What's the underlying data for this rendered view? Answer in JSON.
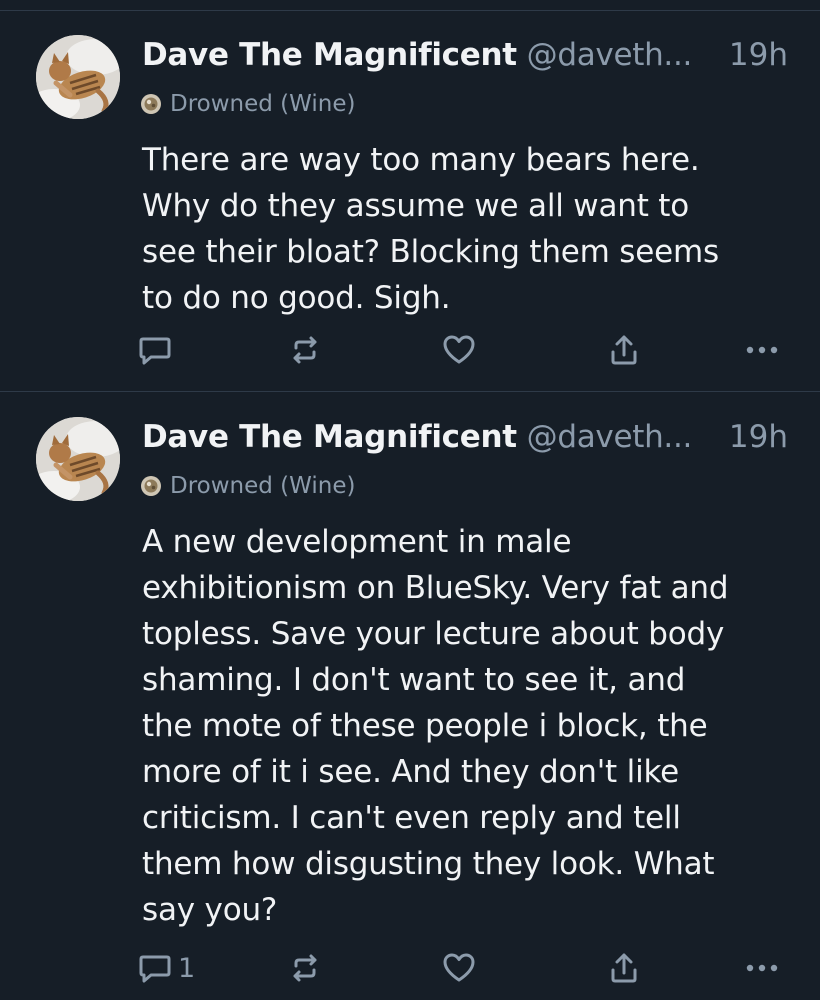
{
  "posts": [
    {
      "author": {
        "display_name": "Dave The Magnificent",
        "handle": "@daveth...",
        "avatar_icon": "cat-avatar"
      },
      "time": "19h",
      "label": {
        "icon": "badge-icon",
        "text": "Drowned (Wine)"
      },
      "text": "There are way too many bears here.\nWhy do they assume we all want to\nsee their bloat? Blocking them seems\nto do no good. Sigh.",
      "actions": {
        "reply_count": "",
        "icons": [
          "reply-icon",
          "repost-icon",
          "like-icon",
          "share-icon",
          "more-icon"
        ]
      }
    },
    {
      "author": {
        "display_name": "Dave The Magnificent",
        "handle": "@daveth...",
        "avatar_icon": "cat-avatar"
      },
      "time": "19h",
      "label": {
        "icon": "badge-icon",
        "text": "Drowned (Wine)"
      },
      "text": "A new development in male\nexhibitionism on BlueSky. Very fat and\ntopless. Save your lecture about body\nshaming. I don't want to see it, and\nthe mote of these people i block, the\nmore of it i see. And they don't like\ncriticism. I can't even reply and tell\nthem how disgusting they look. What\nsay you?",
      "actions": {
        "reply_count": "1",
        "icons": [
          "reply-icon",
          "repost-icon",
          "like-icon",
          "share-icon",
          "more-icon"
        ]
      }
    }
  ],
  "colors": {
    "background": "#161e27",
    "text": "#f1f3f5",
    "muted": "#8c9bab",
    "divider": "#2e3a48"
  }
}
